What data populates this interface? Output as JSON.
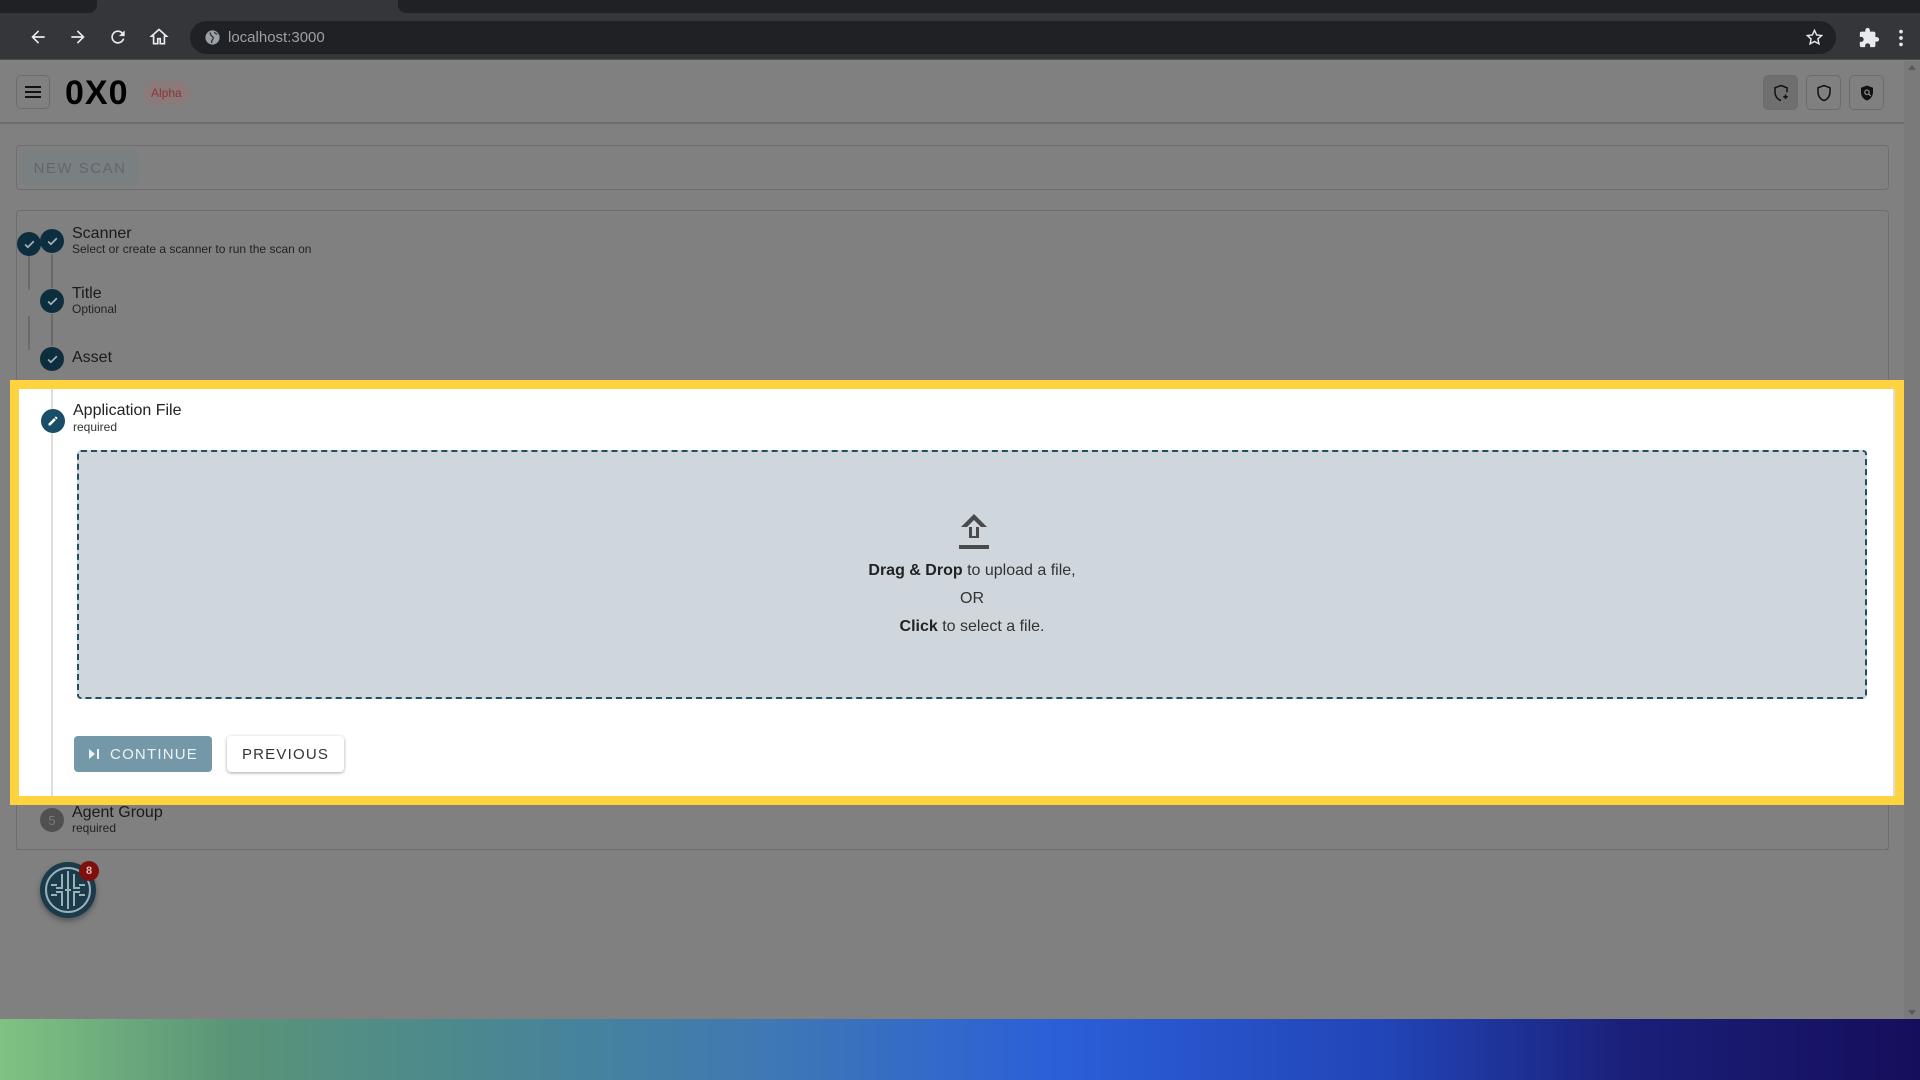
{
  "browser": {
    "url": "localhost:3000",
    "icons": [
      "back-arrow-icon",
      "forward-arrow-icon",
      "reload-icon",
      "home-icon",
      "globe-icon",
      "bookmark-star-icon",
      "extensions-puzzle-icon",
      "more-vert-icon"
    ]
  },
  "header": {
    "logo": "0X0",
    "badge": "Alpha",
    "menu_icon": "hamburger-menu-icon",
    "actions": [
      {
        "name": "new-scan-shield",
        "icon": "shield-plus-icon",
        "active": true
      },
      {
        "name": "scans-shield",
        "icon": "shield-outline-icon",
        "active": false
      },
      {
        "name": "search-shield",
        "icon": "shield-search-icon",
        "active": false
      }
    ]
  },
  "new_scan": {
    "button_label": "NEW SCAN"
  },
  "steps": [
    {
      "index": 1,
      "title": "Scanner",
      "subtitle": "Select or create a scanner to run the scan on",
      "state": "completed"
    },
    {
      "index": 2,
      "title": "Title",
      "subtitle": "Optional",
      "state": "completed"
    },
    {
      "index": 3,
      "title": "Asset",
      "subtitle": "",
      "state": "completed"
    },
    {
      "index": 4,
      "title": "Application File",
      "subtitle": "required",
      "state": "editing"
    },
    {
      "index": 5,
      "title": "Agent Group",
      "subtitle": "required",
      "state": "pending",
      "number": "5"
    }
  ],
  "upload": {
    "line1_bold": "Drag & Drop",
    "line1_rest": " to upload a file,",
    "line2": "OR",
    "line3_bold": "Click",
    "line3_rest": " to select a file."
  },
  "actions": {
    "continue_label": "CONTINUE",
    "previous_label": "PREVIOUS"
  },
  "fab": {
    "badge_count": "8"
  },
  "colors": {
    "highlight": "#ffd23f",
    "primary": "#1a4e68",
    "continue_bg": "#7498a8",
    "dropzone_bg": "#cfd7dc",
    "badge": "#7d0f0f"
  }
}
